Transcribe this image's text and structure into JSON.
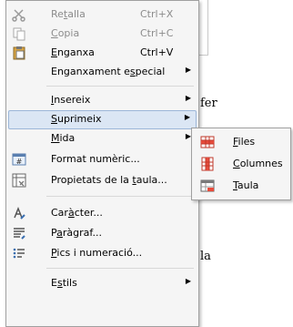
{
  "document": {
    "text_fragments": [
      "fer",
      "la"
    ]
  },
  "context_menu": {
    "items": [
      {
        "label_pre": "Re",
        "label_ul": "t",
        "label_post": "alla",
        "shortcut": "Ctrl+X",
        "icon": "scissors-icon",
        "enabled": false
      },
      {
        "label_pre": "",
        "label_ul": "C",
        "label_post": "opia",
        "shortcut": "Ctrl+C",
        "icon": "copy-icon",
        "enabled": false
      },
      {
        "label_pre": "",
        "label_ul": "E",
        "label_post": "nganxa",
        "shortcut": "Ctrl+V",
        "icon": "paste-icon",
        "enabled": true
      },
      {
        "label_pre": "Enganxament e",
        "label_ul": "s",
        "label_post": "pecial",
        "has_submenu": true
      },
      {
        "label_pre": "",
        "label_ul": "I",
        "label_post": "nsereix",
        "has_submenu": true
      },
      {
        "label_pre": "",
        "label_ul": "S",
        "label_post": "uprimeix",
        "has_submenu": true,
        "highlighted": true
      },
      {
        "label_pre": "",
        "label_ul": "M",
        "label_post": "ida",
        "has_submenu": true
      },
      {
        "label_pre": "Format numèric...",
        "label_ul": "",
        "label_post": "",
        "icon": "number-format-icon"
      },
      {
        "label_pre": "Propietats de la ",
        "label_ul": "t",
        "label_post": "aula...",
        "icon": "table-properties-icon"
      },
      {
        "label_pre": "Car",
        "label_ul": "à",
        "label_post": "cter...",
        "icon": "character-icon"
      },
      {
        "label_pre": "P",
        "label_ul": "a",
        "label_post": "ràgraf...",
        "icon": "paragraph-icon"
      },
      {
        "label_pre": "",
        "label_ul": "P",
        "label_post": "ics i numeració...",
        "icon": "bullets-numbering-icon"
      },
      {
        "label_pre": "E",
        "label_ul": "s",
        "label_post": "tils",
        "has_submenu": true
      }
    ]
  },
  "submenu": {
    "items": [
      {
        "label_ul": "F",
        "label_post": "iles",
        "icon": "delete-rows-icon"
      },
      {
        "label_ul": "C",
        "label_post": "olumnes",
        "icon": "delete-columns-icon"
      },
      {
        "label_ul": "T",
        "label_post": "aula",
        "icon": "delete-table-icon"
      }
    ]
  },
  "colors": {
    "menu_bg": "#f5f5f5",
    "highlight_bg": "#dbe6f4",
    "highlight_border": "#9cb6d8",
    "disabled_text": "#8c8c8c",
    "icon_red": "#c0392b"
  }
}
